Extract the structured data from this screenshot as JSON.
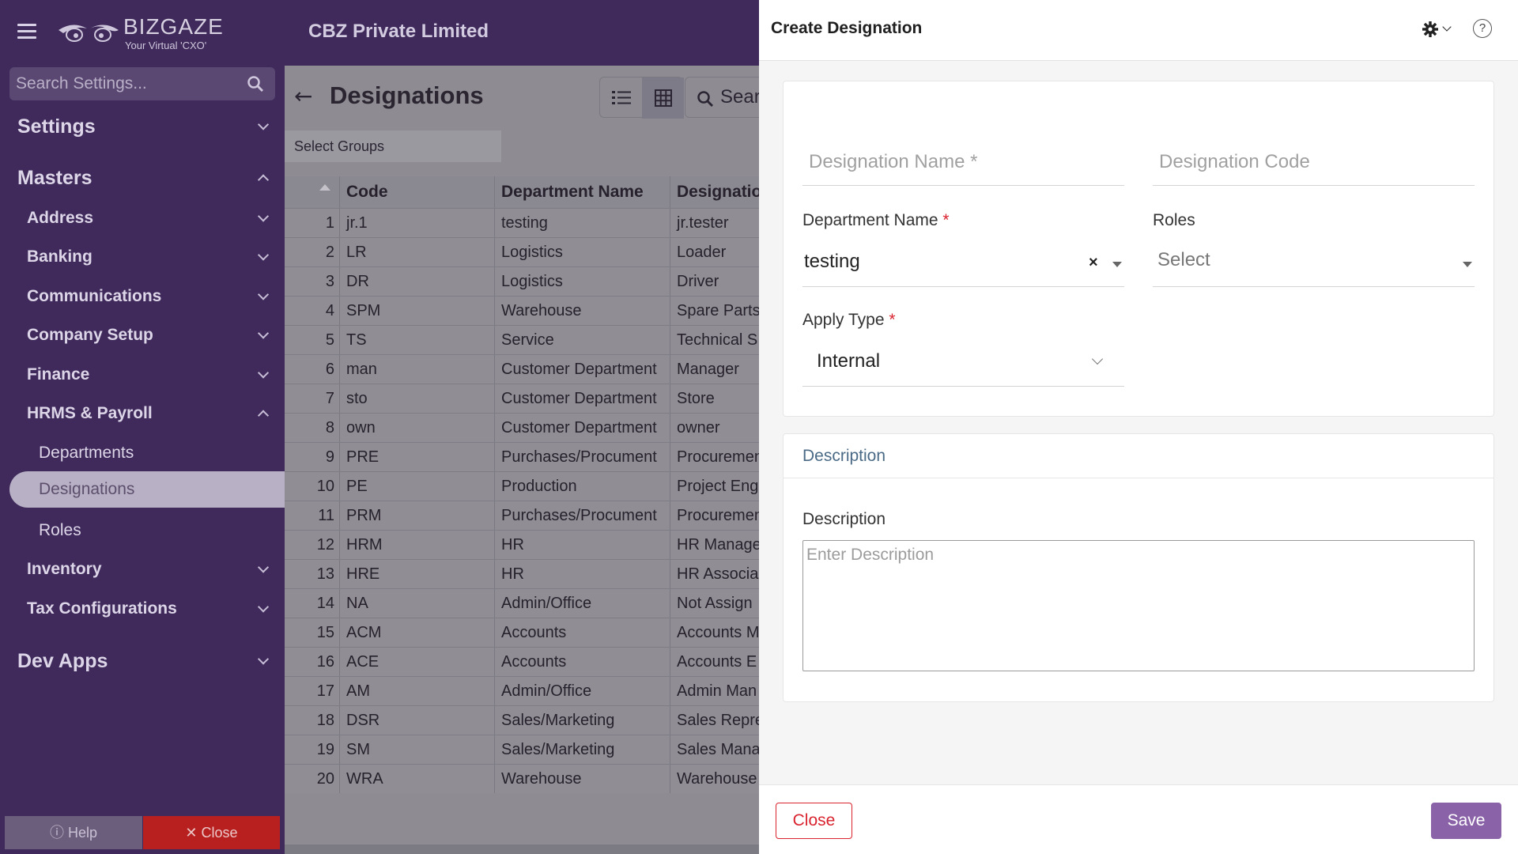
{
  "header": {
    "logo_text": "BIZGAZE",
    "logo_tagline": "Your Virtual 'CXO'",
    "company": "CBZ Private Limited"
  },
  "sidebar": {
    "search_placeholder": "Search Settings...",
    "settings": "Settings",
    "masters": "Masters",
    "items": {
      "address": "Address",
      "banking": "Banking",
      "communications": "Communications",
      "company_setup": "Company Setup",
      "finance": "Finance",
      "hrms": "HRMS & Payroll",
      "departments": "Departments",
      "designations": "Designations",
      "roles": "Roles",
      "inventory": "Inventory",
      "tax": "Tax Configurations"
    },
    "dev_apps": "Dev Apps",
    "help": "Help",
    "close": "Close"
  },
  "main": {
    "title": "Designations",
    "search_text": "Sear",
    "groups_placeholder": "Select Groups",
    "columns": [
      "Code",
      "Department Name",
      "Designatio"
    ],
    "rows": [
      [
        "1",
        "jr.1",
        "testing",
        "jr.tester"
      ],
      [
        "2",
        "LR",
        "Logistics",
        "Loader"
      ],
      [
        "3",
        "DR",
        "Logistics",
        "Driver"
      ],
      [
        "4",
        "SPM",
        "Warehouse",
        "Spare Parts"
      ],
      [
        "5",
        "TS",
        "Service",
        "Technical S"
      ],
      [
        "6",
        "man",
        "Customer Department",
        "Manager"
      ],
      [
        "7",
        "sto",
        "Customer Department",
        "Store"
      ],
      [
        "8",
        "own",
        "Customer Department",
        "owner"
      ],
      [
        "9",
        "PRE",
        "Purchases/Procument",
        "Procuremen"
      ],
      [
        "10",
        "PE",
        "Production",
        "Project Eng"
      ],
      [
        "11",
        "PRM",
        "Purchases/Procument",
        "Procuremen"
      ],
      [
        "12",
        "HRM",
        "HR",
        "HR Manage"
      ],
      [
        "13",
        "HRE",
        "HR",
        "HR Associa"
      ],
      [
        "14",
        "NA",
        "Admin/Office",
        "Not Assign"
      ],
      [
        "15",
        "ACM",
        "Accounts",
        "Accounts M"
      ],
      [
        "16",
        "ACE",
        "Accounts",
        "Accounts E"
      ],
      [
        "17",
        "AM",
        "Admin/Office",
        "Admin Man"
      ],
      [
        "18",
        "DSR",
        "Sales/Marketing",
        "Sales Repre"
      ],
      [
        "19",
        "SM",
        "Sales/Marketing",
        "Sales Mana"
      ],
      [
        "20",
        "WRA",
        "Warehouse",
        "Warehouse"
      ]
    ]
  },
  "panel": {
    "title": "Create Designation",
    "designation_name_placeholder": "Designation Name *",
    "designation_code_placeholder": "Designation Code",
    "department_label": "Department Name",
    "department_value": "testing",
    "roles_label": "Roles",
    "roles_placeholder": "Select",
    "apply_type_label": "Apply Type",
    "apply_type_value": "Internal",
    "required_mark": "*",
    "description_section": "Description",
    "description_label": "Description",
    "description_placeholder": "Enter Description",
    "close_button": "Close",
    "save_button": "Save"
  },
  "colors": {
    "sidebar_bg": "#3f2a5b",
    "overlay_bg": "#8e8c92",
    "save_button": "#8a62a8",
    "close_button": "#d9232f"
  }
}
